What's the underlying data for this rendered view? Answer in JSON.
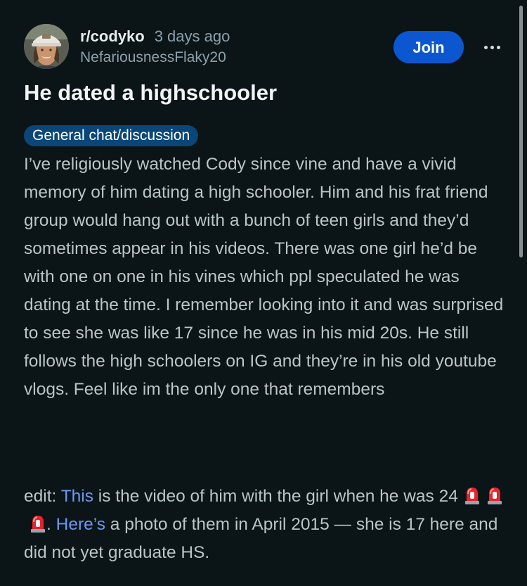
{
  "post": {
    "subreddit": "r/codyko",
    "time_ago": "3 days ago",
    "author": "NefariousnessFlaky20",
    "join_label": "Join",
    "more_icon": "more-horizontal-icon",
    "title": "He dated a highschooler",
    "flair": "General chat/discussion",
    "flair_color": "#0a4778",
    "body": "I’ve religiously watched Cody since vine and have a vivid memory of him dating a high schooler. Him and his frat friend group would hang out with a bunch of teen girls and they’d sometimes appear in his videos. There was one girl he’d be with one on one in his vines which ppl speculated he was dating at the time. I remember looking into it and was surprised to see she was like 17 since he was in his mid 20s. He still follows the high schoolers on IG and they’re in his old youtube vlogs. Feel like im the only one that remembers",
    "edit": {
      "prefix": "edit: ",
      "link1": "This",
      "text1": " is the video of him with the girl when he was 24",
      "emoji": [
        "🚨",
        "🚨",
        "🚨"
      ],
      "text2": ". ",
      "link2": "Here’s",
      "text3": " a photo of them in April 2015 — she is 17 here and did not yet graduate HS."
    }
  },
  "colors": {
    "background": "#0b1416",
    "join_button": "#0c57d0",
    "link": "#6d98f2",
    "body_text": "#b8c5c9"
  }
}
